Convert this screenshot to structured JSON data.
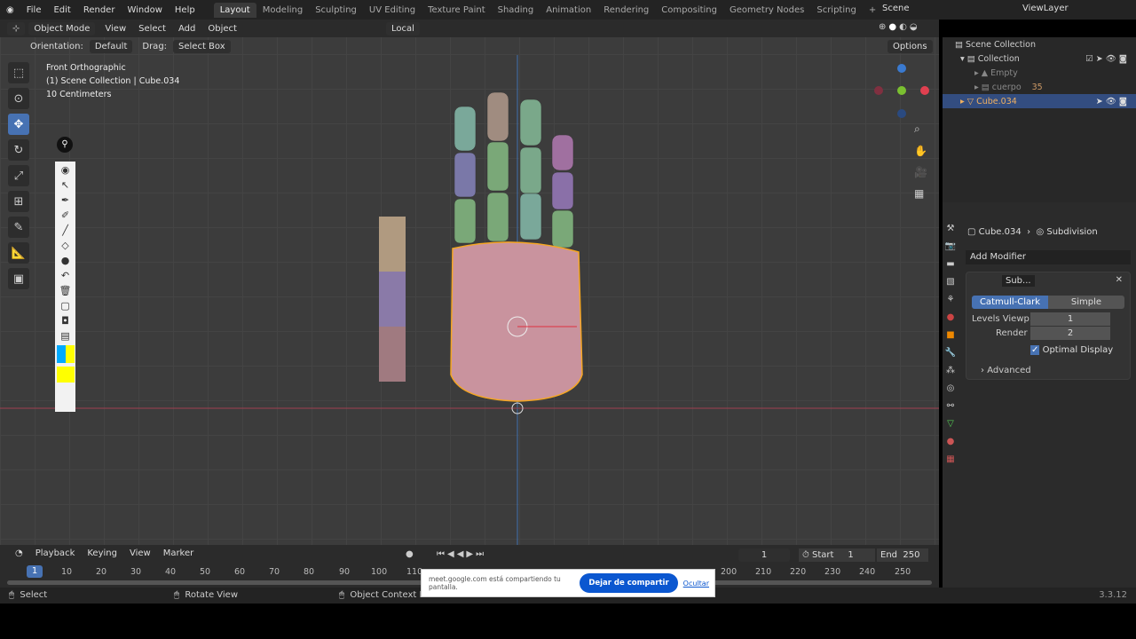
{
  "menu": [
    "File",
    "Edit",
    "Render",
    "Window",
    "Help"
  ],
  "workspaces": [
    "Layout",
    "Modeling",
    "Sculpting",
    "UV Editing",
    "Texture Paint",
    "Shading",
    "Animation",
    "Rendering",
    "Compositing",
    "Geometry Nodes",
    "Scripting",
    "+"
  ],
  "active_workspace": "Layout",
  "scene": "Scene",
  "view_layer": "ViewLayer",
  "header": {
    "mode": "Object Mode",
    "view": "View",
    "select": "Select",
    "add": "Add",
    "object": "Object",
    "pivot": "Local",
    "options": "Options"
  },
  "header2": {
    "orientation_label": "Orientation:",
    "orientation": "Default",
    "drag_label": "Drag:",
    "drag": "Select Box"
  },
  "overlay": {
    "view_name": "Front Orthographic",
    "collection": "(1) Scene Collection | Cube.034",
    "scale": "10 Centimeters"
  },
  "outliner": {
    "root": "Scene Collection",
    "items": [
      {
        "name": "Collection"
      },
      {
        "name": "Empty"
      },
      {
        "name": "cuerpo",
        "badge": "35"
      },
      {
        "name": "Cube.034"
      }
    ]
  },
  "properties": {
    "object": "Cube.034",
    "modifier": "Subdivision",
    "add_modifier": "Add Modifier",
    "mod_name": "Sub...",
    "catmull": "Catmull-Clark",
    "simple": "Simple",
    "levels_label": "Levels Viewp...",
    "levels": "1",
    "render_label": "Render",
    "render": "2",
    "optimal": "Optimal Display",
    "advanced": "Advanced"
  },
  "timeline": {
    "playback": "Playback",
    "keying": "Keying",
    "view": "View",
    "marker": "Marker",
    "current": "1",
    "start_label": "Start",
    "start": "1",
    "end_label": "End",
    "end": "250",
    "ticks": [
      "1",
      "10",
      "20",
      "30",
      "40",
      "50",
      "60",
      "70",
      "80",
      "90",
      "100",
      "110",
      "200",
      "210",
      "220",
      "230",
      "240",
      "250"
    ]
  },
  "status": {
    "select": "Select",
    "rotate": "Rotate View",
    "context": "Object Context M",
    "version": "3.3.12"
  },
  "share": {
    "text": "meet.google.com está compartiendo tu pantalla.",
    "stop": "Dejar de compartir",
    "hide": "Ocultar"
  },
  "colors": {
    "accent": "#4772b3",
    "selected_outline": "#f5a623",
    "mesh": "#c9939e"
  }
}
